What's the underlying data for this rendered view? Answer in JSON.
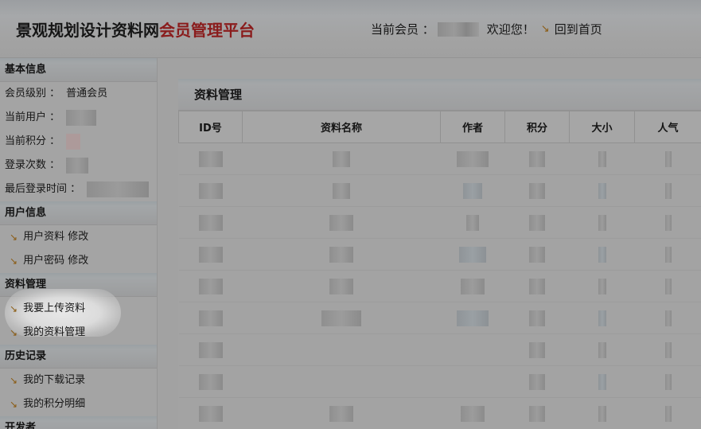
{
  "header": {
    "brand_main": "景观规划设计资料网",
    "brand_accent": "会员管理平台",
    "member_label": "当前会员 ：",
    "welcome": "欢迎您！",
    "home_link": "回到首页"
  },
  "sidebar": {
    "sections": [
      {
        "title": "基本信息",
        "rows": [
          {
            "label": "会员级别 ：",
            "value": "普通会员"
          },
          {
            "label": "当前用户 ：",
            "value": ""
          },
          {
            "label": "当前积分 ：",
            "value": ""
          },
          {
            "label": "登录次数 ：",
            "value": ""
          },
          {
            "label": "最后登录时间 ：",
            "value": ""
          }
        ]
      },
      {
        "title": "用户信息",
        "links": [
          "用户资料 修改",
          "用户密码 修改"
        ]
      },
      {
        "title": "资料管理",
        "links": [
          "我要上传资料",
          "我的资料管理"
        ]
      },
      {
        "title": "历史记录",
        "links": [
          "我的下载记录",
          "我的积分明细"
        ]
      },
      {
        "title": "开发者",
        "links": []
      }
    ]
  },
  "main": {
    "panel_title": "资料管理",
    "columns": [
      "ID号",
      "资料名称",
      "作者",
      "积分",
      "大小",
      "人气"
    ]
  },
  "colors": {
    "accent": "#8a1c1c",
    "arrow": "#8a5a10"
  },
  "icons": {
    "link_arrow": "arrow-down-right-icon"
  }
}
